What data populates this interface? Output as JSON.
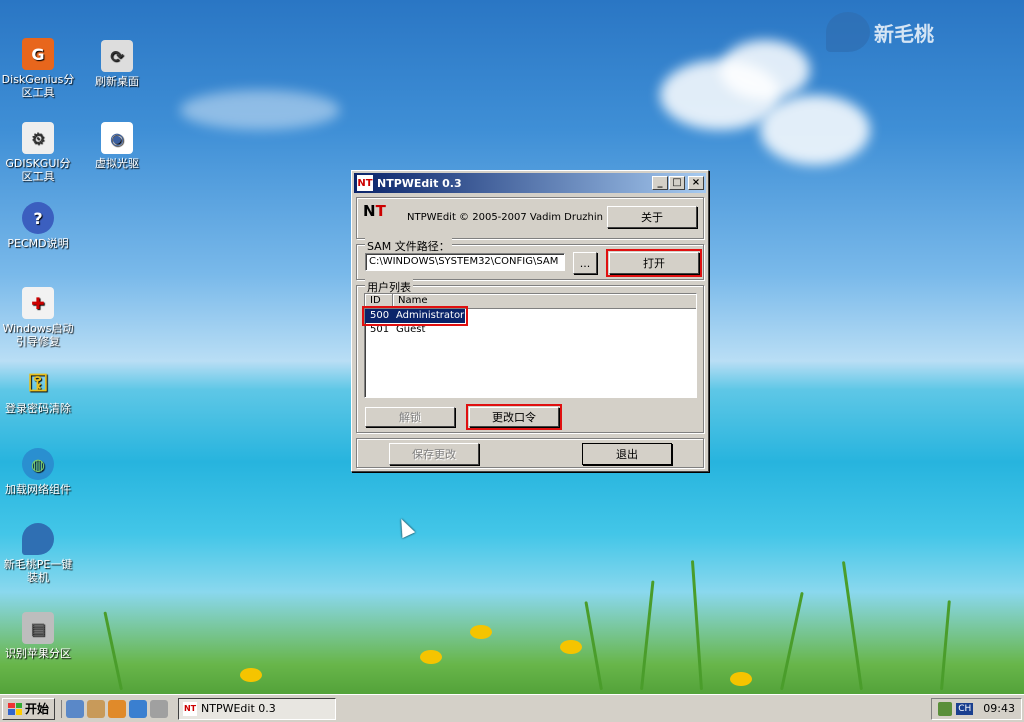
{
  "desktop": {
    "icons": [
      {
        "label": "DiskGenius分区工具",
        "icon": "diskgenius-icon",
        "color": "#e8661c",
        "glyph": "G"
      },
      {
        "label": "GDISKGUI分区工具",
        "icon": "gdiskgui-icon",
        "color": "#eeeeee",
        "glyph": "⚙"
      },
      {
        "label": "PECMD说明",
        "icon": "help-icon",
        "color": "#3b5fbf",
        "glyph": "?"
      },
      {
        "label": "Windows启动引导修复",
        "icon": "boot-repair-icon",
        "color": "#f2f2f2",
        "glyph": "✚"
      },
      {
        "label": "登录密码清除",
        "icon": "key-icon",
        "color": "#e8c020",
        "glyph": "⚿"
      },
      {
        "label": "加载网络组件",
        "icon": "globe-icon",
        "color": "#2a8fd0",
        "glyph": "◍"
      },
      {
        "label": "新毛桃PE一键装机",
        "icon": "peach-icon",
        "color": "#2f6fb3",
        "glyph": "●"
      },
      {
        "label": "识别苹果分区",
        "icon": "drive-icon",
        "color": "#bdbdbd",
        "glyph": "▤"
      },
      {
        "label": "刷新桌面",
        "icon": "refresh-desktop-icon",
        "color": "#dddddd",
        "glyph": "⟳"
      },
      {
        "label": "虚拟光驱",
        "icon": "virtual-cd-icon",
        "color": "#ffffff",
        "glyph": "◉"
      }
    ],
    "brand": "新毛桃"
  },
  "window": {
    "title": "NTPWEdit 0.3",
    "title_icon": "NT",
    "minimize": "_",
    "maximize": "□",
    "close": "×",
    "copyright": "NTPWEdit © 2005-2007 Vadim Druzhin",
    "about_label": "关于",
    "sam_group_label": "SAM 文件路径：",
    "sam_path": "C:\\WINDOWS\\SYSTEM32\\CONFIG\\SAM",
    "browse_label": "...",
    "open_label": "打开",
    "users_group_label": "用户列表",
    "columns": [
      "ID",
      "Name"
    ],
    "users": [
      {
        "id": "500",
        "name": "Administrator"
      },
      {
        "id": "501",
        "name": "Guest"
      }
    ],
    "unlock_label": "解锁",
    "change_password_label": "更改口令",
    "save_label": "保存更改",
    "exit_label": "退出"
  },
  "taskbar": {
    "start_label": "开始",
    "task_label": "NTPWEdit 0.3",
    "ime": "CH",
    "time": "09:43"
  }
}
